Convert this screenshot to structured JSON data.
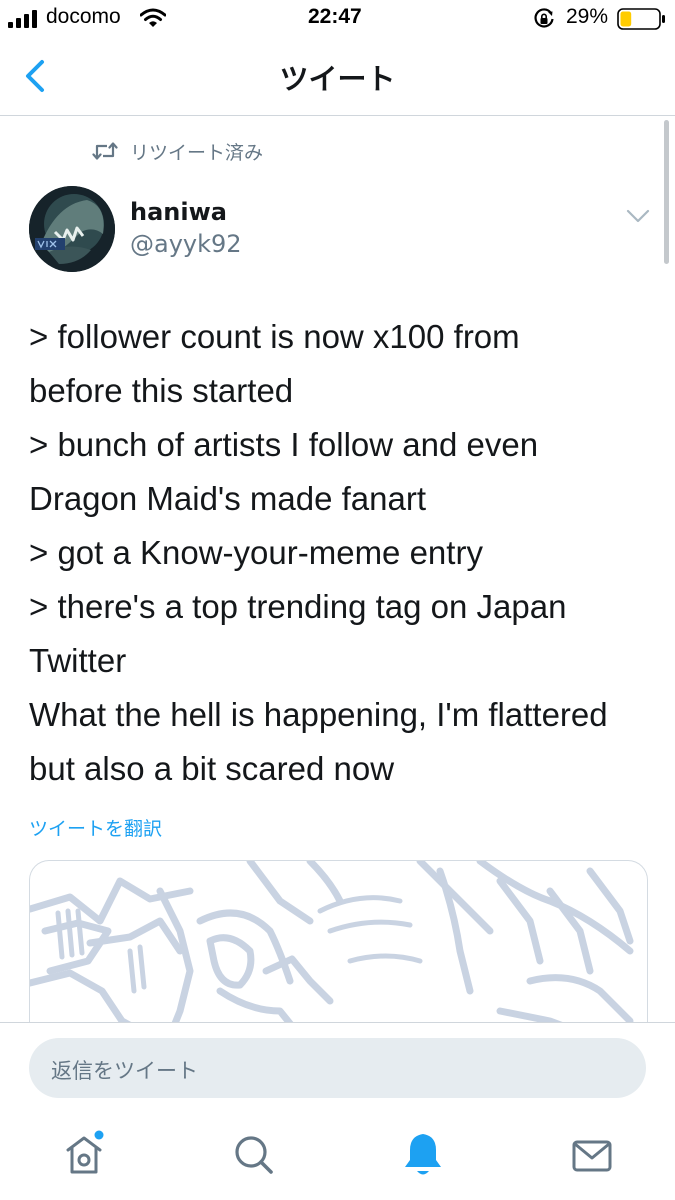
{
  "status_bar": {
    "carrier": "docomo",
    "time": "22:47",
    "battery_percent": "29%",
    "battery_level": 0.29,
    "icons": [
      "signal-icon",
      "wifi-icon",
      "rotation-lock-icon",
      "battery-icon"
    ]
  },
  "nav": {
    "title": "ツイート",
    "back_icon": "back-chevron-icon"
  },
  "tweet": {
    "retweet_label": "リツイート済み",
    "author": {
      "name": "haniwa",
      "handle": "@ayyk92"
    },
    "lines": [
      "> follower count is now x100 from",
      "before this started",
      "> bunch of artists I follow and even",
      "Dragon Maid's made fanart",
      "> got a Know-your-meme entry",
      "> there's a top trending tag on Japan",
      "Twitter",
      "What the hell is happening, I'm flattered",
      "but also a bit scared now"
    ],
    "translate_label": "ツイートを翻訳"
  },
  "reply": {
    "placeholder": "返信をツイート"
  },
  "tab_bar": {
    "items": [
      {
        "name": "home",
        "icon": "home-icon",
        "has_badge": true
      },
      {
        "name": "search",
        "icon": "search-icon"
      },
      {
        "name": "notifications",
        "icon": "bell-icon",
        "active": true
      },
      {
        "name": "messages",
        "icon": "mail-icon"
      }
    ]
  },
  "colors": {
    "accent": "#1da1f2",
    "text": "#14171a",
    "secondary_text": "#657786",
    "battery_fill": "#ffcc00"
  }
}
